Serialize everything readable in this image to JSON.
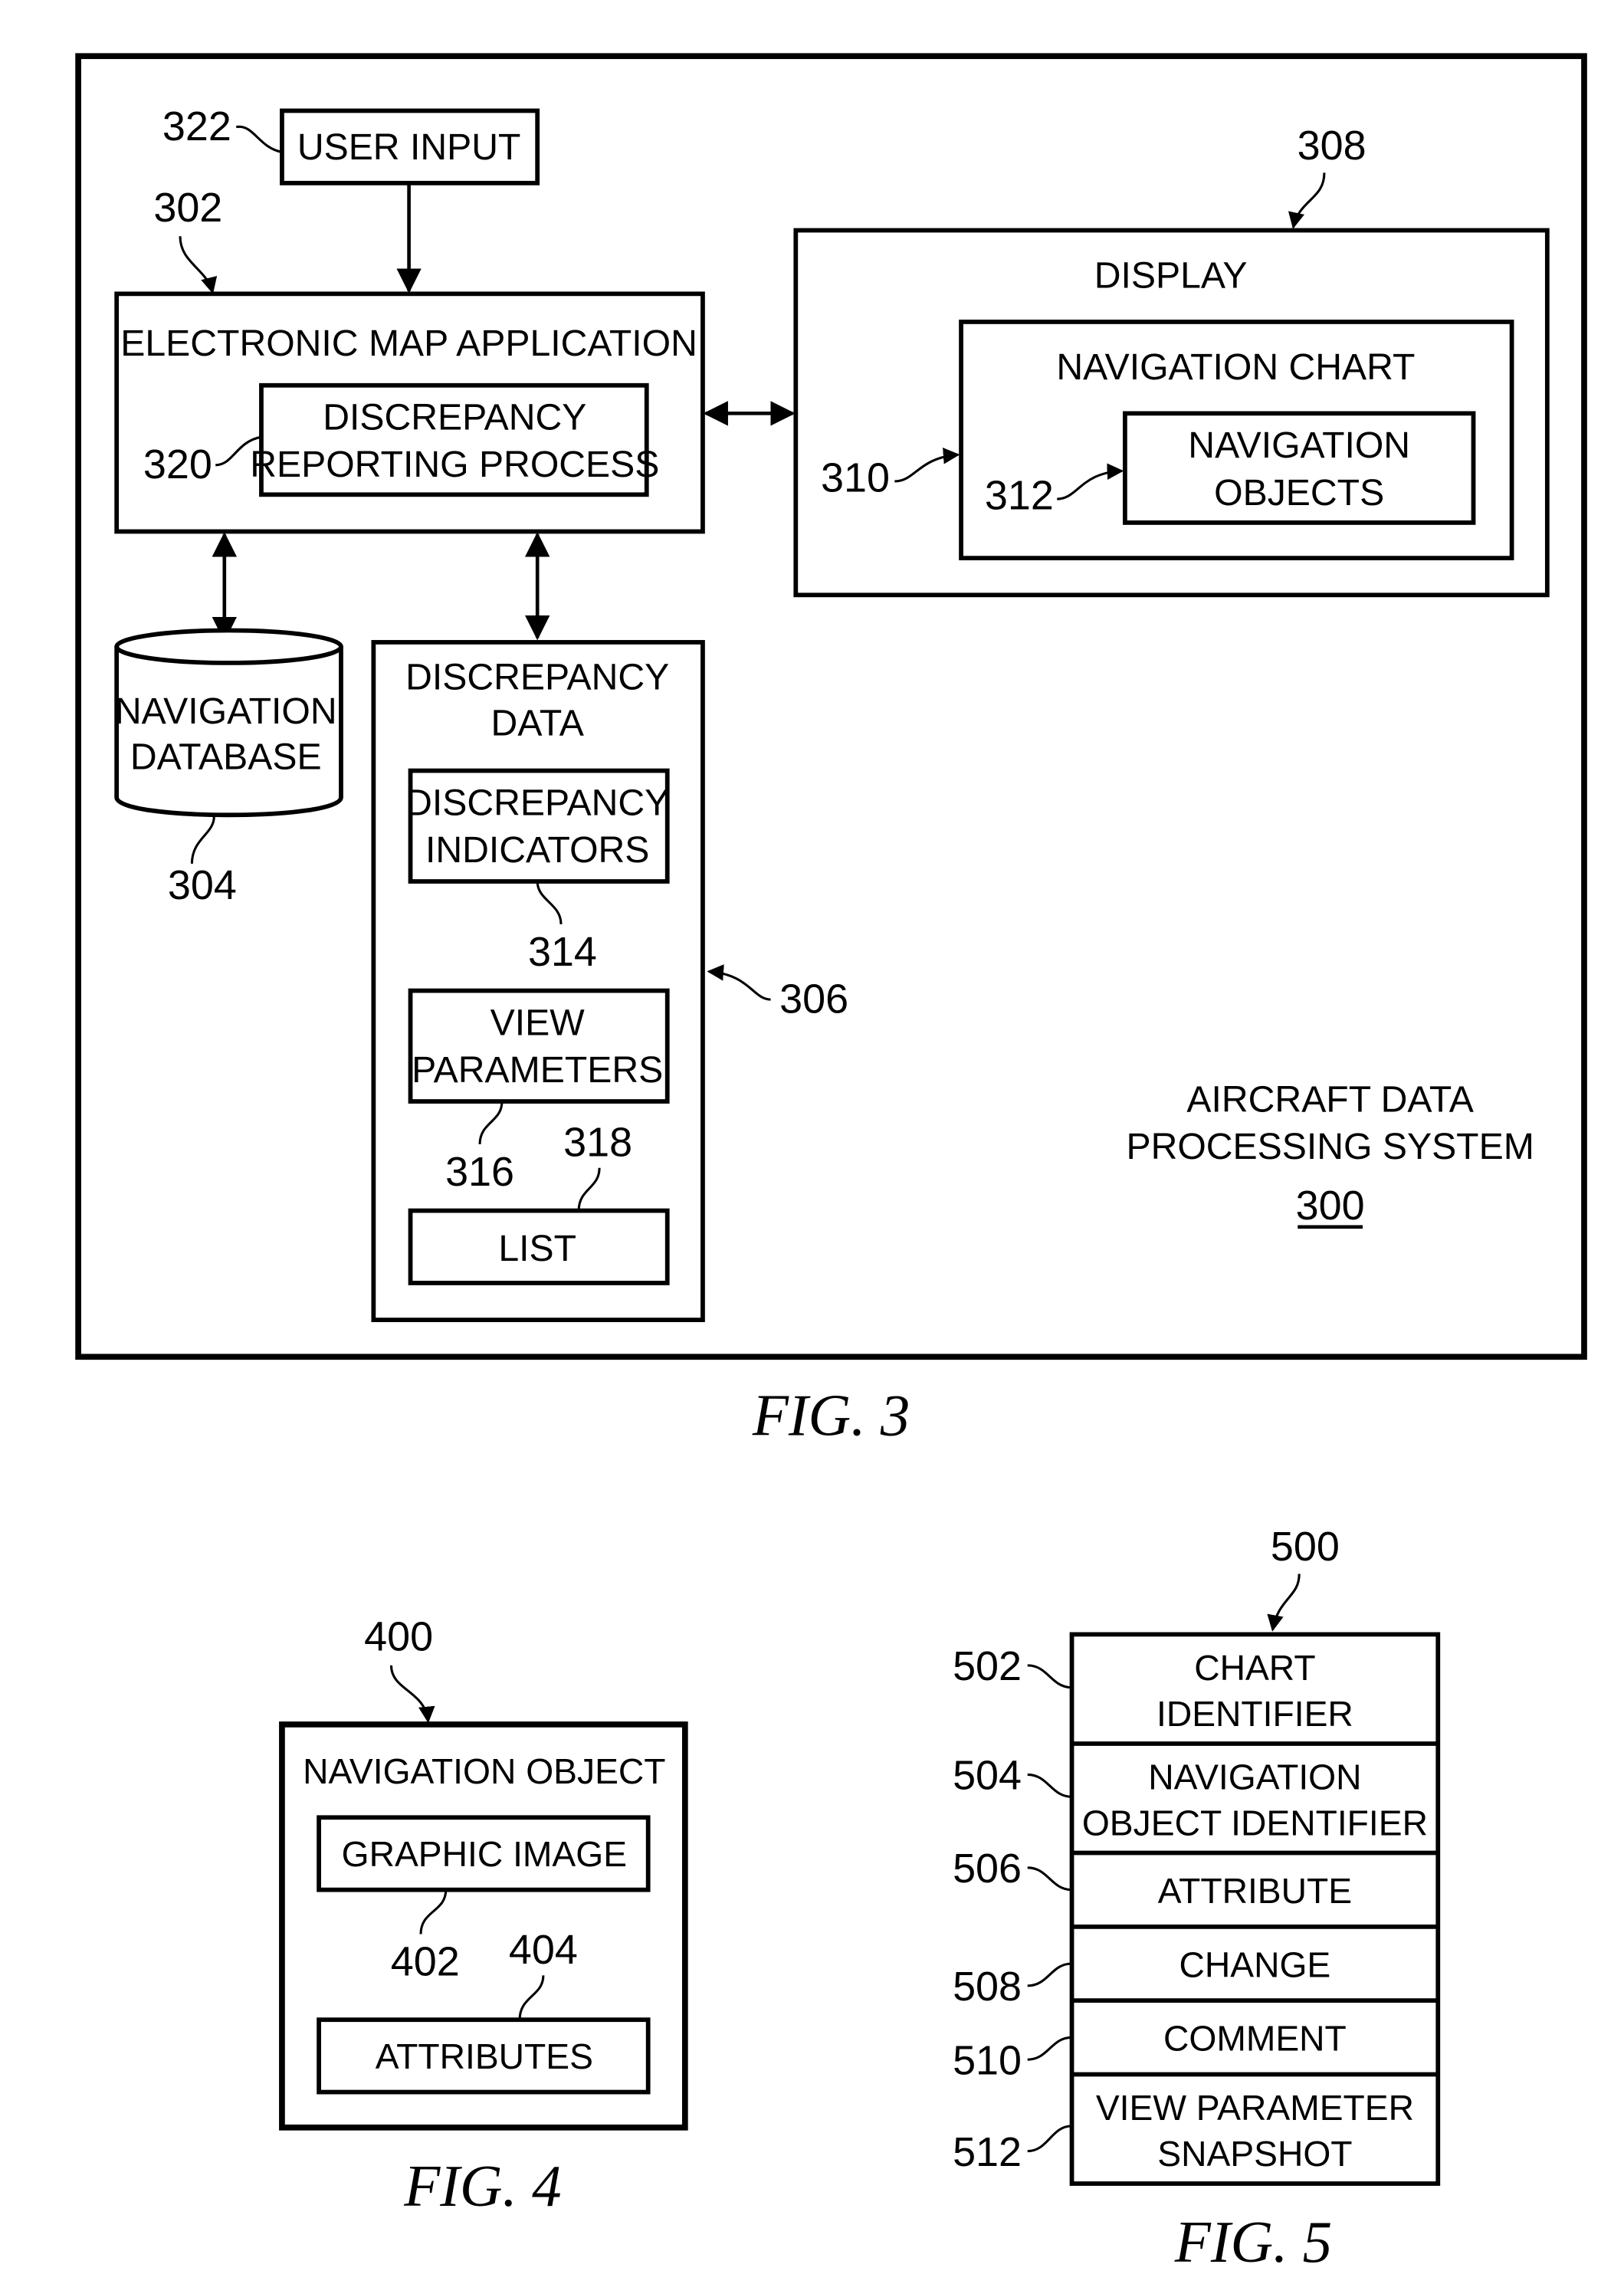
{
  "figures": [
    {
      "caption": "FIG. 3",
      "system": {
        "title_line1": "AIRCRAFT DATA",
        "title_line2": "PROCESSING SYSTEM",
        "ref": "300"
      },
      "user_input": {
        "label": "USER INPUT",
        "ref": "322"
      },
      "electronic_map_application": {
        "label": "ELECTRONIC MAP APPLICATION",
        "ref": "302",
        "discrepancy_reporting_process": {
          "line1": "DISCREPANCY",
          "line2": "REPORTING PROCESS",
          "ref": "320"
        }
      },
      "navigation_database": {
        "line1": "NAVIGATION",
        "line2": "DATABASE",
        "ref": "304"
      },
      "discrepancy_data": {
        "line1": "DISCREPANCY",
        "line2": "DATA",
        "ref": "306",
        "discrepancy_indicators": {
          "line1": "DISCREPANCY",
          "line2": "INDICATORS",
          "ref": "314"
        },
        "view_parameters": {
          "line1": "VIEW",
          "line2": "PARAMETERS",
          "ref": "316"
        },
        "list": {
          "label": "LIST",
          "ref": "318"
        }
      },
      "display": {
        "label": "DISPLAY",
        "ref": "308",
        "navigation_chart": {
          "label": "NAVIGATION CHART",
          "ref": "310",
          "navigation_objects": {
            "line1": "NAVIGATION",
            "line2": "OBJECTS",
            "ref": "312"
          }
        }
      }
    },
    {
      "caption": "FIG. 4",
      "navigation_object": {
        "label": "NAVIGATION OBJECT",
        "ref": "400",
        "graphic_image": {
          "label": "GRAPHIC IMAGE",
          "ref": "402"
        },
        "attributes": {
          "label": "ATTRIBUTES",
          "ref": "404"
        }
      }
    },
    {
      "caption": "FIG. 5",
      "record_ref": "500",
      "fields": [
        {
          "line1": "CHART",
          "line2": "IDENTIFIER",
          "ref": "502"
        },
        {
          "line1": "NAVIGATION",
          "line2": "OBJECT IDENTIFIER",
          "ref": "504"
        },
        {
          "line1": "ATTRIBUTE",
          "line2": "",
          "ref": "506"
        },
        {
          "line1": "CHANGE",
          "line2": "",
          "ref": "508"
        },
        {
          "line1": "COMMENT",
          "line2": "",
          "ref": "510"
        },
        {
          "line1": "VIEW PARAMETER",
          "line2": "SNAPSHOT",
          "ref": "512"
        }
      ]
    }
  ]
}
